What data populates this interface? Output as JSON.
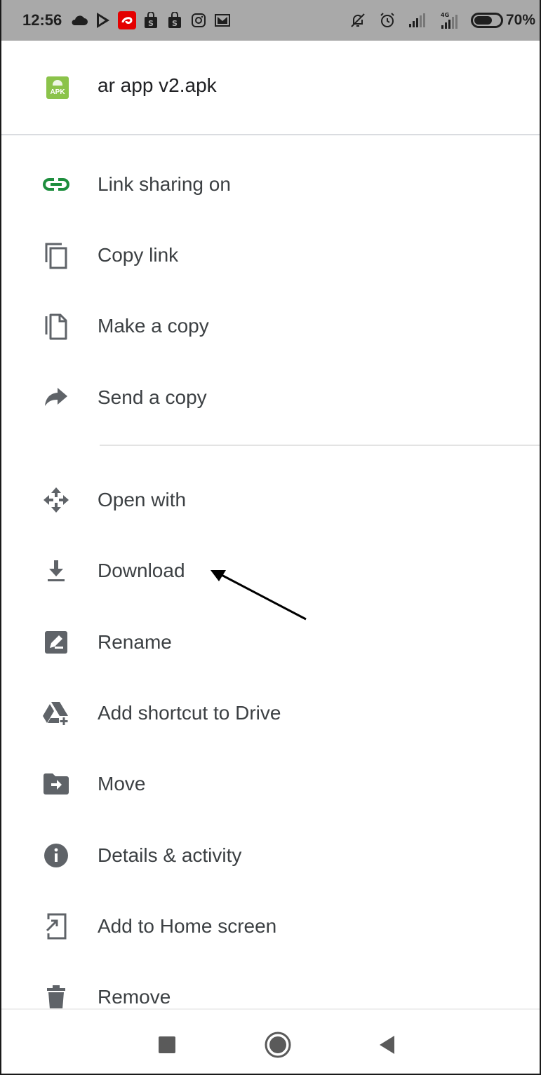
{
  "status_bar": {
    "time": "12:56",
    "battery": "70%",
    "network_label": "4G",
    "icons_left": [
      "cloud-icon",
      "play-store-icon",
      "airtel-icon",
      "shopping-bag-icon",
      "shopping-bag-icon",
      "instagram-icon",
      "gmail-icon"
    ],
    "icons_right": [
      "mute-icon",
      "alarm-icon",
      "signal-icon",
      "signal-4g-icon",
      "battery-icon"
    ]
  },
  "file": {
    "icon_label": "APK",
    "name": "ar app v2.apk",
    "icon_color": "#8bc34a"
  },
  "menu": {
    "items": [
      {
        "label": "Link sharing on",
        "icon": "link-icon",
        "icon_color": "#1e8e3e"
      },
      {
        "label": "Copy link",
        "icon": "copy-link-icon"
      },
      {
        "label": "Make a copy",
        "icon": "file-copy-icon"
      },
      {
        "label": "Send a copy",
        "icon": "share-arrow-icon"
      },
      {
        "label": "Open with",
        "icon": "open-with-icon"
      },
      {
        "label": "Download",
        "icon": "download-icon"
      },
      {
        "label": "Rename",
        "icon": "rename-icon"
      },
      {
        "label": "Add shortcut to Drive",
        "icon": "drive-shortcut-icon"
      },
      {
        "label": "Move",
        "icon": "move-folder-icon"
      },
      {
        "label": "Details & activity",
        "icon": "info-icon"
      },
      {
        "label": "Add to Home screen",
        "icon": "add-to-home-icon"
      },
      {
        "label": "Remove",
        "icon": "trash-icon"
      }
    ]
  },
  "nav_bar": {
    "buttons": [
      "recents-icon",
      "home-icon",
      "back-icon"
    ]
  },
  "colors": {
    "status_bar_bg": "#a9a9a9",
    "icon_gray": "#5f6368",
    "text": "#3c4043",
    "link_green": "#1e8e3e"
  }
}
